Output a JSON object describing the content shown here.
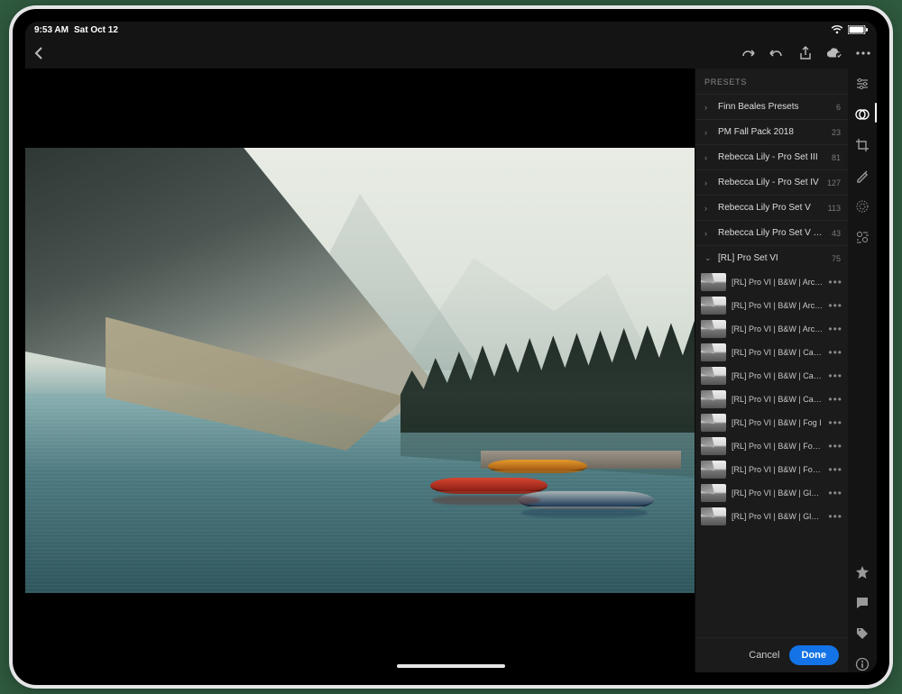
{
  "status": {
    "time": "9:53 AM",
    "date": "Sat Oct 12"
  },
  "panel": {
    "title": "PRESETS",
    "groups": [
      {
        "label": "Finn Beales Presets",
        "count": "6",
        "open": false
      },
      {
        "label": "PM Fall Pack 2018",
        "count": "23",
        "open": false
      },
      {
        "label": "Rebecca Lily - Pro Set III",
        "count": "81",
        "open": false
      },
      {
        "label": "Rebecca Lily - Pro Set IV",
        "count": "127",
        "open": false
      },
      {
        "label": "Rebecca Lily Pro Set V",
        "count": "113",
        "open": false
      },
      {
        "label": "Rebecca Lily Pro Set V Tools",
        "count": "43",
        "open": false
      },
      {
        "label": "[RL] Pro Set VI",
        "count": "75",
        "open": true
      }
    ],
    "open_presets": [
      "[RL] Pro VI | B&W | Arctic I",
      "[RL] Pro VI | B&W | Arctic II",
      "[RL] Pro VI | B&W | Arctic III",
      "[RL] Pro VI | B&W | Casablanca I",
      "[RL] Pro VI | B&W | Casablanca II",
      "[RL] Pro VI | B&W | Casablanca III",
      "[RL] Pro VI | B&W | Fog I",
      "[RL] Pro VI | B&W | Fog II",
      "[RL] Pro VI | B&W | Fog III",
      "[RL] Pro VI | B&W | Glacier I",
      "[RL] Pro VI | B&W | Glacier II"
    ],
    "footer": {
      "cancel": "Cancel",
      "done": "Done"
    }
  }
}
